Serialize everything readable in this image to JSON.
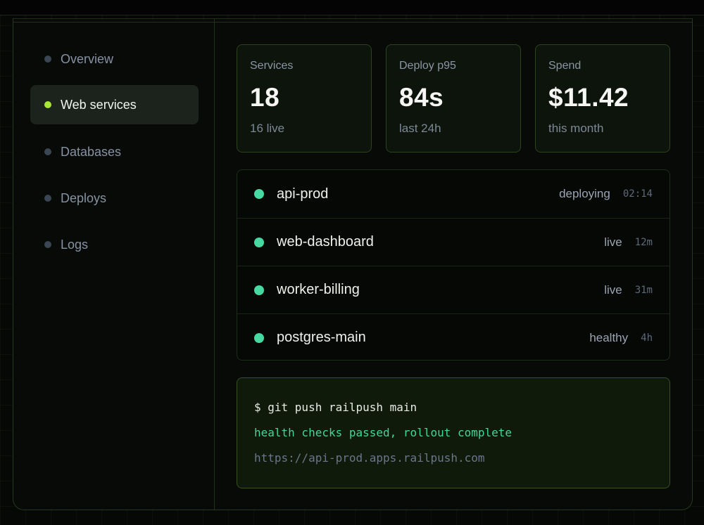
{
  "sidebar": {
    "items": [
      {
        "label": "Overview",
        "active": false
      },
      {
        "label": "Web services",
        "active": true
      },
      {
        "label": "Databases",
        "active": false
      },
      {
        "label": "Deploys",
        "active": false
      },
      {
        "label": "Logs",
        "active": false
      }
    ]
  },
  "stats": [
    {
      "title": "Services",
      "value": "18",
      "sub": "16 live"
    },
    {
      "title": "Deploy p95",
      "value": "84s",
      "sub": "last 24h"
    },
    {
      "title": "Spend",
      "value": "$11.42",
      "sub": "this month"
    }
  ],
  "services": [
    {
      "name": "api-prod",
      "status": "deploying",
      "time": "02:14"
    },
    {
      "name": "web-dashboard",
      "status": "live",
      "time": "12m"
    },
    {
      "name": "worker-billing",
      "status": "live",
      "time": "31m"
    },
    {
      "name": "postgres-main",
      "status": "healthy",
      "time": "4h"
    }
  ],
  "terminal": {
    "command": "$ git push railpush main",
    "result": "health checks passed, rollout complete",
    "url": "https://api-prod.apps.railpush.com"
  },
  "colors": {
    "accent": "#a8e63a",
    "status_ok": "#46d9a2"
  }
}
